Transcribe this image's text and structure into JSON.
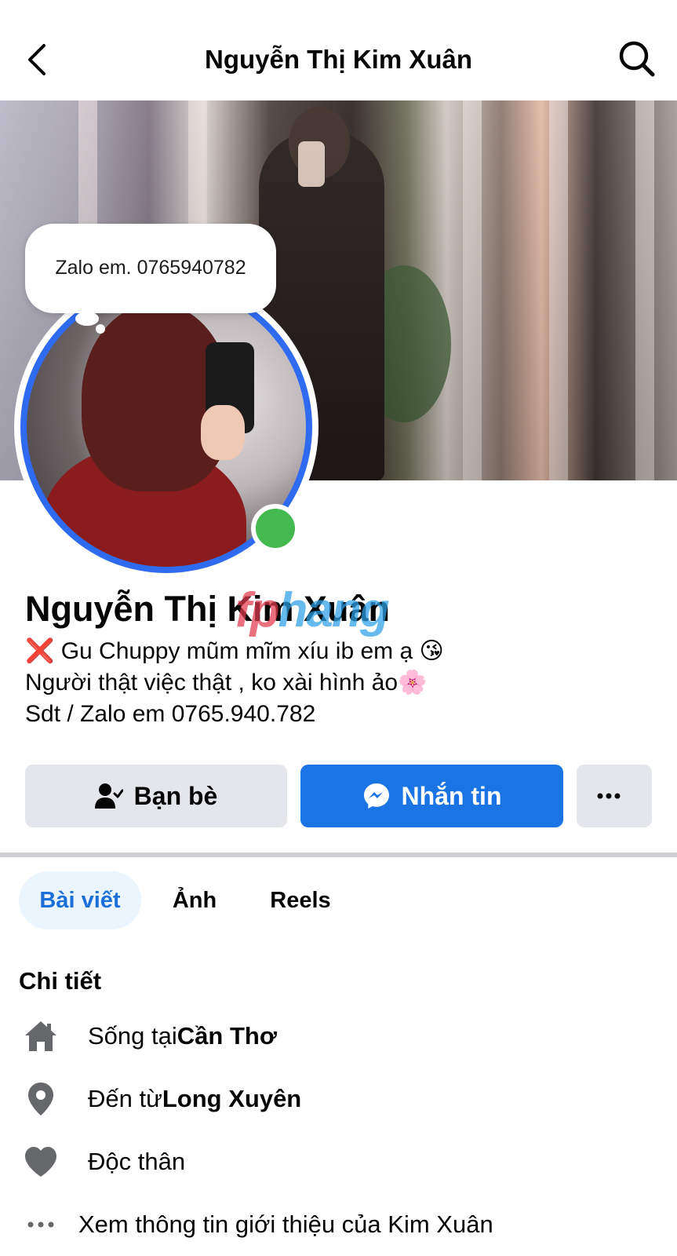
{
  "header": {
    "title": "Nguyễn Thị Kim Xuân",
    "back_icon": "chevron-left-icon",
    "search_icon": "search-icon"
  },
  "note_bubble": {
    "text": "Zalo em. 0765940782"
  },
  "profile": {
    "name": "Nguyễn Thị Kim Xuân",
    "online": true,
    "bio": {
      "line1_emoji": "❌",
      "line1_text": " Gu Chuppy mũm mĩm xíu ib em ạ 😘",
      "line2": "Người thật việc thật , ko xài hình ảo🌸",
      "line3": "Sdt / Zalo em 0765.940.782"
    }
  },
  "watermark": {
    "part1": "fp",
    "part2": "hang"
  },
  "actions": {
    "friends_label": "Bạn bè",
    "message_label": "Nhắn tin",
    "more_label": "···"
  },
  "tabs": [
    {
      "label": "Bài viết",
      "active": true
    },
    {
      "label": "Ảnh",
      "active": false
    },
    {
      "label": "Reels",
      "active": false
    }
  ],
  "details": {
    "title": "Chi tiết",
    "items": [
      {
        "icon": "home-icon",
        "prefix": "Sống tại ",
        "value": "Cần Thơ"
      },
      {
        "icon": "location-pin-icon",
        "prefix": "Đến từ ",
        "value": "Long Xuyên"
      },
      {
        "icon": "heart-icon",
        "prefix": "Độc thân",
        "value": ""
      },
      {
        "icon": "more-dots-icon",
        "prefix": "Xem thông tin giới thiệu của Kim Xuân",
        "value": ""
      }
    ]
  },
  "colors": {
    "accent_blue": "#1b74e4",
    "avatar_ring": "#2f6bf0",
    "online_green": "#44b950",
    "tab_active_bg": "#ebf5ff",
    "button_gray": "#e4e6eb"
  }
}
